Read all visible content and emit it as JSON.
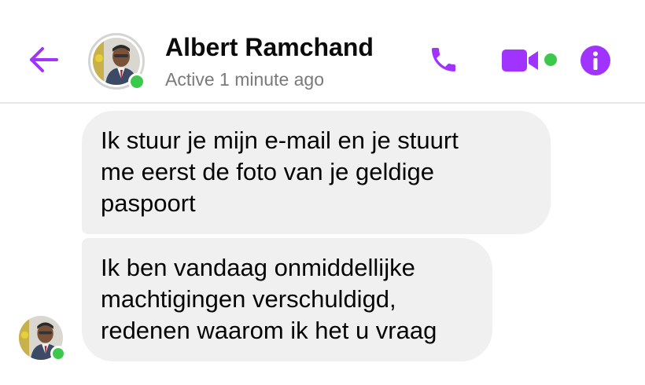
{
  "header": {
    "contact_name": "Albert Ramchand",
    "status": "Active 1 minute ago",
    "back_icon": "arrow-left-icon",
    "call_icon": "phone-icon",
    "video_icon": "video-camera-icon",
    "info_icon": "info-icon"
  },
  "messages": [
    {
      "text": "Ik stuur je mijn e-mail en je stuurt\nme eerst de foto van je geldige\npaspoort"
    },
    {
      "text": "Ik ben vandaag onmiddellijke\nmachtigingen verschuldigd,\nredenen waarom ik het u vraag"
    }
  ],
  "colors": {
    "accent": "#a033ff",
    "online": "#3cc84a",
    "bubble": "#f0f0f0",
    "status_text": "#7a7a7a"
  }
}
